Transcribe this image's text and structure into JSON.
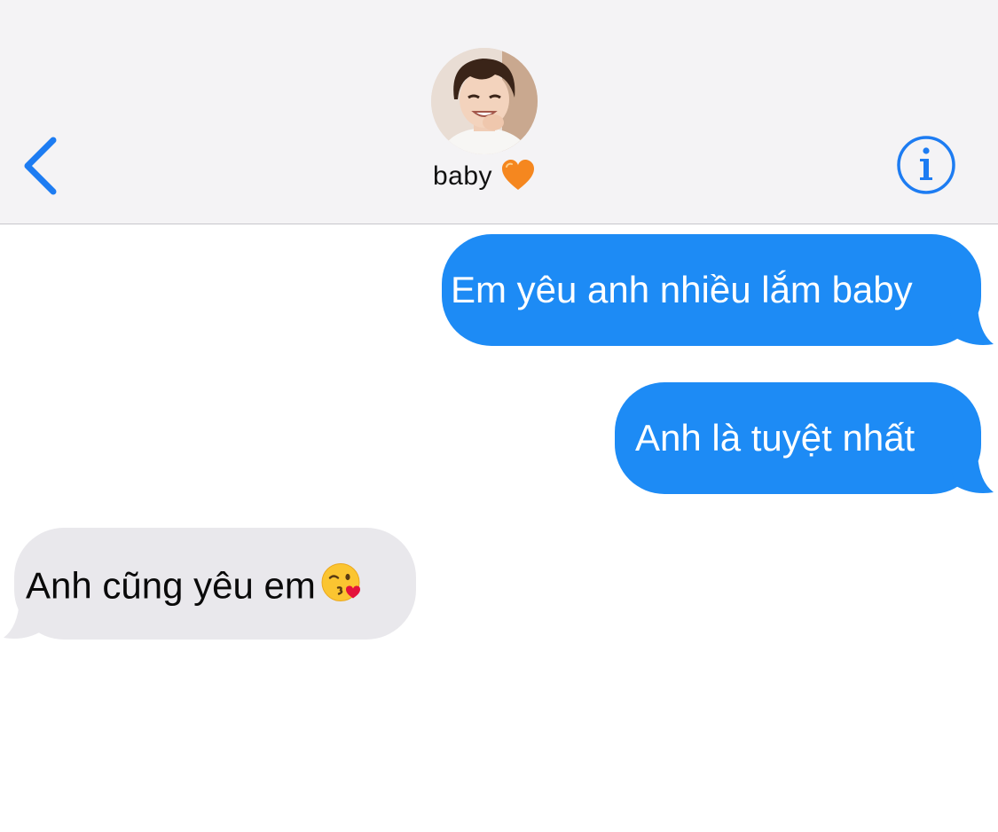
{
  "header": {
    "contact_name": "baby",
    "heart_icon": "orange-heart-icon",
    "avatar_icon": "contact-avatar",
    "back_icon": "chevron-left-icon",
    "info_icon": "info-icon"
  },
  "messages": [
    {
      "direction": "sent",
      "text": "Em yêu anh nhiều lắm baby"
    },
    {
      "direction": "sent",
      "text": "Anh là tuyệt nhất"
    },
    {
      "direction": "received",
      "text": "Anh cũng yêu em",
      "emoji": "kissing-face-emoji"
    }
  ],
  "colors": {
    "accent": "#1d8bf5",
    "header_bg": "#f4f3f5",
    "received_bubble": "#e9e8ec",
    "heart": "#f5871f"
  }
}
